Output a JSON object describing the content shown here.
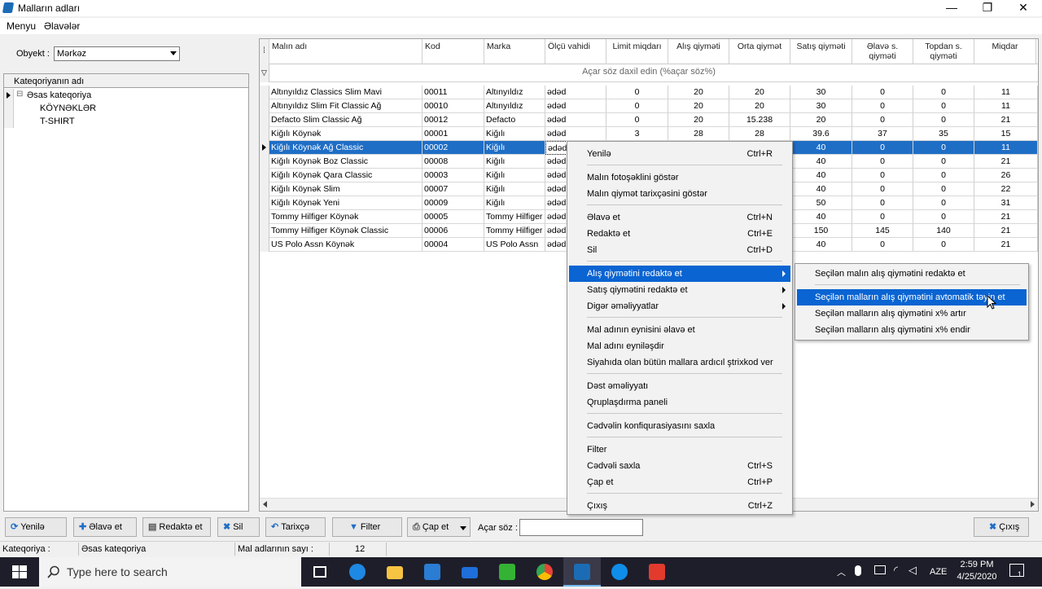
{
  "window": {
    "title": "Malların adları",
    "min_glyph": "—",
    "max_glyph": "❐",
    "close_glyph": "✕"
  },
  "menubar": [
    "Menyu",
    "Əlavələr"
  ],
  "object": {
    "label": "Obyekt :",
    "value": "Mərkəz"
  },
  "tree": {
    "header": "Kateqoriyanın adı",
    "items": [
      {
        "label": "Əsas kateqoriya",
        "expander": "⊟"
      },
      {
        "label": "KÖYNƏKLƏR"
      },
      {
        "label": "T-SHIRT"
      }
    ]
  },
  "grid": {
    "columns": [
      "Malın adı",
      "Kod",
      "Marka",
      "Ölçü vahidi",
      "Limit miqdarı",
      "Alış qiymәti",
      "Orta qiymәt",
      "Satış qiymәti",
      "Əlavә s. qiymәti",
      "Topdan s. qiymәti",
      "Miqdar"
    ],
    "filter_placeholder": "Açar söz daxil edin (%açar söz%)",
    "rows": [
      [
        "Altınyıldız Classics Slim Mavi",
        "00011",
        "Altınyıldız",
        "ədəd",
        "0",
        "20",
        "20",
        "30",
        "0",
        "0",
        "11"
      ],
      [
        "Altınyıldız Slim Fit Classic Ağ",
        "00010",
        "Altınyıldız",
        "ədəd",
        "0",
        "20",
        "20",
        "30",
        "0",
        "0",
        "11"
      ],
      [
        "Defacto Slim Classic Ağ",
        "00012",
        "Defacto",
        "ədəd",
        "0",
        "20",
        "15.238",
        "20",
        "0",
        "0",
        "21"
      ],
      [
        "Kiğılı Köynək",
        "00001",
        "Kiğılı",
        "ədəd",
        "3",
        "28",
        "28",
        "39.6",
        "37",
        "35",
        "15"
      ],
      [
        "Kiğılı Köynək Ağ Classic",
        "00002",
        "Kiğılı",
        "ədəd",
        "",
        "",
        "",
        "40",
        "0",
        "0",
        "11"
      ],
      [
        "Kiğılı Köynək Boz Classic",
        "00008",
        "Kiğılı",
        "ədəd",
        "",
        "",
        "",
        "40",
        "0",
        "0",
        "21"
      ],
      [
        "Kiğılı Köynək Qara Classic",
        "00003",
        "Kiğılı",
        "ədəd",
        "",
        "",
        "",
        "40",
        "0",
        "0",
        "26"
      ],
      [
        "Kiğılı Köynək Slim",
        "00007",
        "Kiğılı",
        "ədəd",
        "",
        "",
        "",
        "40",
        "0",
        "0",
        "22"
      ],
      [
        "Kiğılı Köynək Yeni",
        "00009",
        "Kiğılı",
        "ədəd",
        "",
        "",
        "",
        "50",
        "0",
        "0",
        "31"
      ],
      [
        "Tommy Hilfiger Köynək",
        "00005",
        "Tommy Hilfiger",
        "ədəd",
        "",
        "",
        "",
        "40",
        "0",
        "0",
        "21"
      ],
      [
        "Tommy Hilfiger Köynək Classic",
        "00006",
        "Tommy Hilfiger",
        "ədəd",
        "",
        "",
        "",
        "150",
        "145",
        "140",
        "21"
      ],
      [
        "US Polo Assn Köynək",
        "00004",
        "US Polo Assn",
        "ədəd",
        "",
        "",
        "",
        "40",
        "0",
        "0",
        "21"
      ]
    ],
    "selected_row": 4
  },
  "context_menu": {
    "items": [
      {
        "label": "Yenilə",
        "shortcut": "Ctrl+R"
      },
      {
        "label": "Malın fotoşəklini göstər"
      },
      {
        "label": "Malın qiymət tarixçəsini göstər"
      },
      {
        "label": "Əlavə et",
        "shortcut": "Ctrl+N"
      },
      {
        "label": "Redaktə et",
        "shortcut": "Ctrl+E"
      },
      {
        "label": "Sil",
        "shortcut": "Ctrl+D"
      },
      {
        "label": "Alış qiymətini redaktə et",
        "submenu": true,
        "highlighted": true
      },
      {
        "label": "Satış qiymətini redaktə et",
        "submenu": true
      },
      {
        "label": "Digər əməliyyatlar",
        "submenu": true
      },
      {
        "label": "Mal adının eynisini əlavə et"
      },
      {
        "label": "Mal adını eyniləşdir"
      },
      {
        "label": "Siyahıda olan bütün mallara ardıcıl ştrixkod ver"
      },
      {
        "label": "Dəst əməliyyatı"
      },
      {
        "label": "Qruplaşdırma paneli"
      },
      {
        "label": "Cədvəlin konfiqurasiyasını saxla"
      },
      {
        "label": "Filter"
      },
      {
        "label": "Cədvəli saxla",
        "shortcut": "Ctrl+S"
      },
      {
        "label": "Çap et",
        "shortcut": "Ctrl+P"
      },
      {
        "label": "Çıxış",
        "shortcut": "Ctrl+Z"
      }
    ],
    "submenu": [
      {
        "label": "Seçilən malın alış qiymətini redaktə et"
      },
      {
        "label": "Seçilən malların alış qiymətini avtomatik təyin et",
        "highlighted": true
      },
      {
        "label": "Seçilən malların alış qiymətini x% artır"
      },
      {
        "label": "Seçilən malların alış qiymətini x% endir"
      }
    ]
  },
  "toolbar": {
    "refresh": "Yenilə",
    "add": "Əlavə et",
    "edit": "Redaktə et",
    "delete": "Sil",
    "history": "Tarixçə",
    "filter": "Filter",
    "print": "Çap et",
    "search_label": "Açar söz :",
    "exit": "Çıxış"
  },
  "status": {
    "category_label": "Kateqoriya :",
    "category_value": "Əsas kateqoriya",
    "count_label": "Mal adlarının sayı :",
    "count_value": "12"
  },
  "taskbar": {
    "search_placeholder": "Type here to search",
    "lang": "AZE",
    "time": "2:59 PM",
    "date": "4/25/2020",
    "notif_count": "1"
  },
  "colors": {
    "selection": "#1f6ec6",
    "menu_highlight": "#0a64d2",
    "taskbar": "#1e1e2a"
  }
}
